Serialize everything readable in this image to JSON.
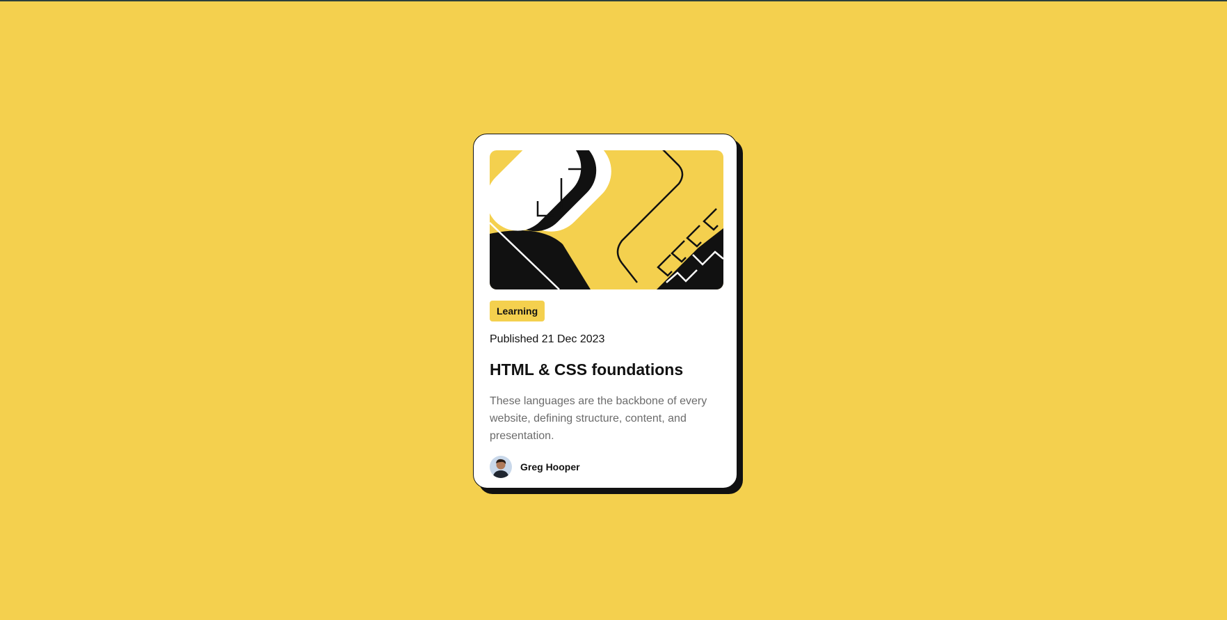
{
  "theme": {
    "background": "#f4d04e",
    "card_background": "#ffffff",
    "ink": "#111111",
    "muted_text": "#6b6b6b",
    "accent": "#f4d04e"
  },
  "card": {
    "illustration_icon": "abstract-code-illustration",
    "tag": "Learning",
    "published": "Published 21 Dec 2023",
    "title": "HTML & CSS foundations",
    "description": "These languages are the backbone of every website, defining structure, content, and presentation.",
    "author": {
      "name": "Greg Hooper",
      "avatar_icon": "author-avatar"
    }
  }
}
